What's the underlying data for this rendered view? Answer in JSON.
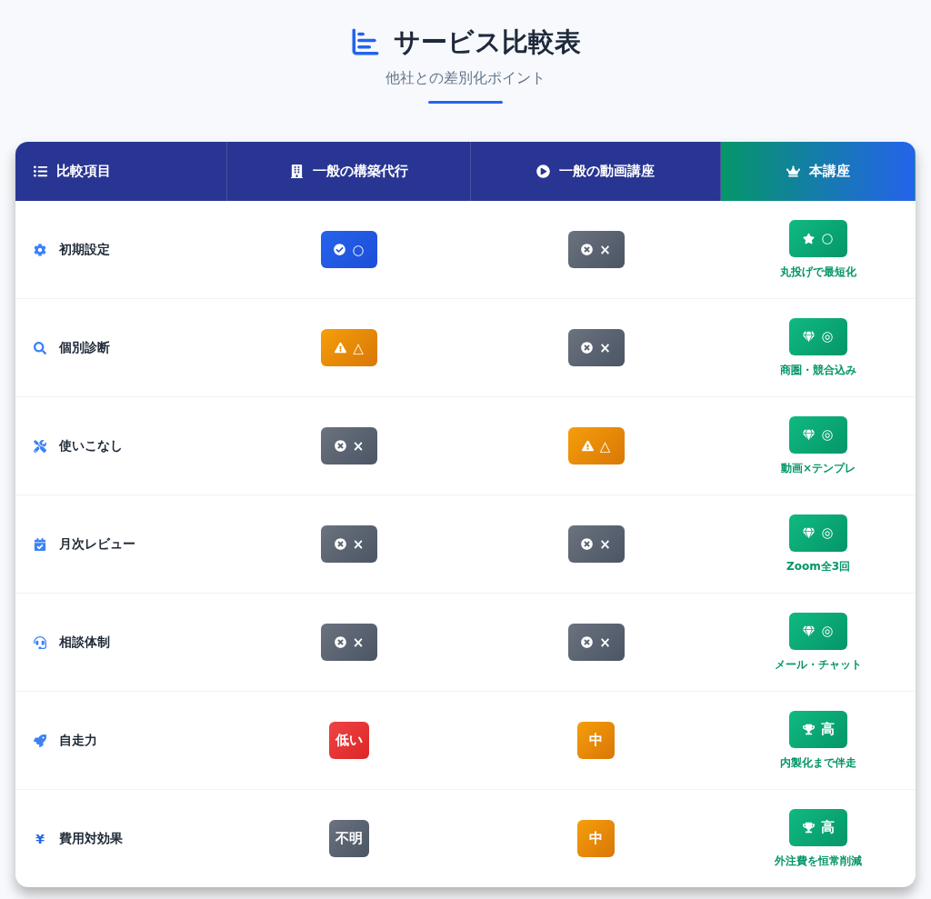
{
  "header": {
    "title": "サービス比較表",
    "subtitle": "他社との差別化ポイント"
  },
  "columns": [
    {
      "label": "比較項目",
      "highlighted": false
    },
    {
      "label": "一般の構築代行",
      "highlighted": false
    },
    {
      "label": "一般の動画講座",
      "highlighted": false
    },
    {
      "label": "本講座",
      "highlighted": true
    }
  ],
  "rows": [
    {
      "label": "初期設定",
      "cells": [
        {
          "kind": "check",
          "symbol": "○"
        },
        {
          "kind": "cross",
          "symbol": "×"
        },
        {
          "kind": "star",
          "symbol": "○",
          "note": "丸投げで最短化"
        }
      ]
    },
    {
      "label": "個別診断",
      "cells": [
        {
          "kind": "caution",
          "symbol": "△"
        },
        {
          "kind": "cross",
          "symbol": "×"
        },
        {
          "kind": "gem",
          "symbol": "◎",
          "note": "商圏・競合込み"
        }
      ]
    },
    {
      "label": "使いこなし",
      "cells": [
        {
          "kind": "cross",
          "symbol": "×"
        },
        {
          "kind": "caution",
          "symbol": "△"
        },
        {
          "kind": "gem",
          "symbol": "◎",
          "note": "動画×テンプレ"
        }
      ]
    },
    {
      "label": "月次レビュー",
      "cells": [
        {
          "kind": "cross",
          "symbol": "×"
        },
        {
          "kind": "cross",
          "symbol": "×"
        },
        {
          "kind": "gem",
          "symbol": "◎",
          "note": "Zoom全3回"
        }
      ]
    },
    {
      "label": "相談体制",
      "cells": [
        {
          "kind": "cross",
          "symbol": "×"
        },
        {
          "kind": "cross",
          "symbol": "×"
        },
        {
          "kind": "gem",
          "symbol": "◎",
          "note": "メール・チャット"
        }
      ]
    },
    {
      "label": "自走力",
      "cells": [
        {
          "kind": "low",
          "symbol": "低い"
        },
        {
          "kind": "medium",
          "symbol": "中"
        },
        {
          "kind": "trophy",
          "symbol": "高",
          "note": "内製化まで伴走"
        }
      ]
    },
    {
      "label": "費用対効果",
      "symbol": "¥",
      "cells": [
        {
          "kind": "unknown",
          "symbol": "不明"
        },
        {
          "kind": "medium",
          "symbol": "中"
        },
        {
          "kind": "trophy",
          "symbol": "高",
          "note": "外注費を恒常削減"
        }
      ]
    }
  ]
}
